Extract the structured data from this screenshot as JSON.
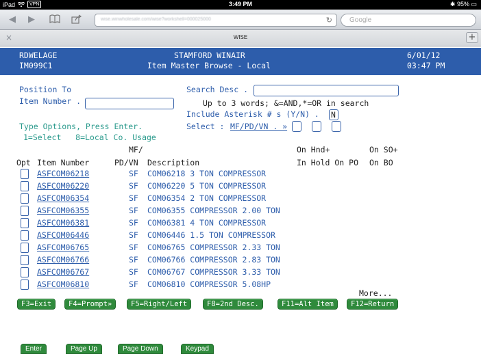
{
  "status_bar": {
    "device": "iPad",
    "vpn": "VPN",
    "time": "3:49 PM",
    "battery": "95%"
  },
  "browser": {
    "url": "wise.winwholesale.com/wise?workshell=000025000",
    "search_placeholder": "Google",
    "tab_title": "WISE",
    "back_icon": "◀",
    "forward_icon": "▶",
    "bookmarks_icon": "📖",
    "share_icon": "⇪",
    "reload_icon": "↻",
    "close_icon": "×",
    "add_tab_icon": "+"
  },
  "header": {
    "user": "RDWELAGE",
    "company": "STAMFORD WINAIR",
    "date": "6/01/12",
    "program": "IM099C1",
    "screen_title": "Item Master Browse - Local",
    "time": "03:47 PM"
  },
  "form": {
    "position_to": "Position To",
    "item_number_label": "Item Number .",
    "item_number_value": "",
    "search_desc_label": "Search Desc .",
    "search_desc_value": "",
    "search_hint": "Up to 3 words; &=AND,*=OR in search",
    "include_asterisk_label": "Include Asterisk # s (Y/N) .",
    "include_asterisk_value": "N",
    "type_options": "Type Options, Press Enter.",
    "options_legend": "1=Select   8=Local Co. Usage",
    "select_label": "Select : ",
    "select_link": "MF/PD/VN . »",
    "select_values": [
      "",
      "",
      ""
    ]
  },
  "columns": {
    "mf_top": "MF/",
    "on_hnd_top": "On Hnd+",
    "on_so_top": "On SO+",
    "opt": "Opt",
    "item_number": "Item Number",
    "pdvn": "PD/VN",
    "description": "Description",
    "in_hold_on_po": "In Hold On PO",
    "on_bo": "On BO"
  },
  "rows": [
    {
      "item": "ASFCOM06218",
      "src": "SF",
      "desc": "COM06218 3 TON COMPRESSOR"
    },
    {
      "item": "ASFCOM06220",
      "src": "SF",
      "desc": "COM06220 5 TON COMPRESSOR"
    },
    {
      "item": "ASFCOM06354",
      "src": "SF",
      "desc": "COM06354 2 TON COMPRESSOR"
    },
    {
      "item": "ASFCOM06355",
      "src": "SF",
      "desc": "COM06355 COMPRESSOR 2.00 TON"
    },
    {
      "item": "ASFCOM06381",
      "src": "SF",
      "desc": "COM06381 4 TON COMPRESSOR"
    },
    {
      "item": "ASFCOM06446",
      "src": "SF",
      "desc": "COM06446 1.5 TON COMPRESSOR"
    },
    {
      "item": "ASFCOM06765",
      "src": "SF",
      "desc": "COM06765 COMPRESSOR 2.33 TON"
    },
    {
      "item": "ASFCOM06766",
      "src": "SF",
      "desc": "COM06766 COMPRESSOR 2.83 TON"
    },
    {
      "item": "ASFCOM06767",
      "src": "SF",
      "desc": "COM06767 COMPRESSOR 3.33 TON"
    },
    {
      "item": "ASFCOM06810",
      "src": "SF",
      "desc": "COM06810 COMPRESSOR 5.08HP"
    }
  ],
  "more": "More...",
  "function_keys": [
    "F3=Exit",
    "F4=Prompt»",
    "F5=Right/Left",
    "F8=2nd Desc.",
    "F11=Alt Item",
    "F12=Return"
  ],
  "bottom_buttons": [
    "Enter",
    "Page Up",
    "Page Down",
    "Keypad"
  ],
  "colors": {
    "header_bg": "#2d5dab",
    "teal_text": "#2a9a8c",
    "button_green": "#2f8a3c"
  }
}
